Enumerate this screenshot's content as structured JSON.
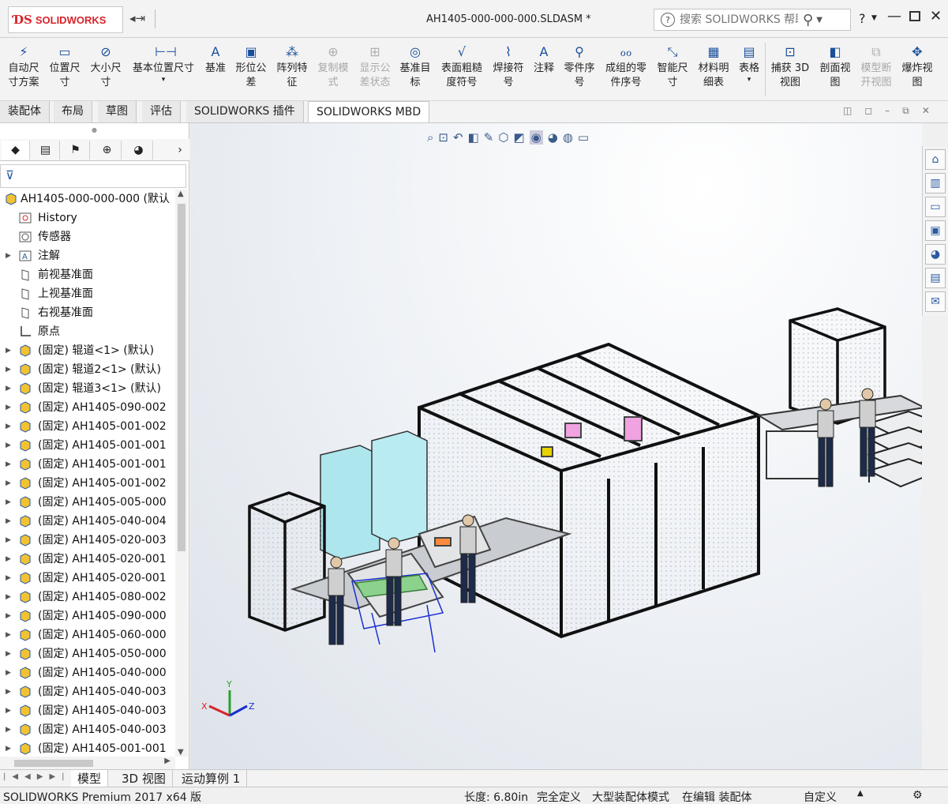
{
  "app": {
    "brand": "SOLIDWORKS",
    "doc_title": "AH1405-000-000-000.SLDASM *",
    "search_placeholder": "搜索 SOLIDWORKS 帮助",
    "help": "?"
  },
  "toolbar": {
    "items": [
      {
        "label1": "自动尺",
        "label2": "寸方案",
        "icon": "auto-dimension-icon"
      },
      {
        "label1": "位置尺",
        "label2": "寸",
        "icon": "location-dimension-icon"
      },
      {
        "label1": "大小尺",
        "label2": "寸",
        "icon": "size-dimension-icon"
      },
      {
        "label1": "基本位置尺寸",
        "label2": "",
        "icon": "basic-location-dimension-icon"
      },
      {
        "label1": "基准",
        "label2": "",
        "icon": "datum-icon"
      },
      {
        "label1": "形位公",
        "label2": "差",
        "icon": "geometric-tolerance-icon"
      },
      {
        "label1": "阵列特",
        "label2": "征",
        "icon": "pattern-feature-icon"
      },
      {
        "label1": "复制模",
        "label2": "式",
        "icon": "copy-scheme-icon"
      },
      {
        "label1": "显示公",
        "label2": "差状态",
        "icon": "show-tolerance-status-icon"
      },
      {
        "label1": "基准目",
        "label2": "标",
        "icon": "datum-target-icon"
      },
      {
        "label1": "表面粗糙",
        "label2": "度符号",
        "icon": "surface-finish-icon"
      },
      {
        "label1": "焊接符",
        "label2": "号",
        "icon": "weld-symbol-icon"
      },
      {
        "label1": "注释",
        "label2": "",
        "icon": "note-icon"
      },
      {
        "label1": "零件序",
        "label2": "号",
        "icon": "balloon-icon"
      },
      {
        "label1": "成组的零",
        "label2": "件序号",
        "icon": "stacked-balloon-icon"
      },
      {
        "label1": "智能尺",
        "label2": "寸",
        "icon": "smart-dimension-icon"
      },
      {
        "label1": "材料明",
        "label2": "细表",
        "icon": "bill-of-materials-icon"
      },
      {
        "label1": "表格",
        "label2": "",
        "icon": "table-icon"
      },
      {
        "label1": "捕获 3D",
        "label2": "视图",
        "icon": "capture-3d-view-icon"
      },
      {
        "label1": "剖面视",
        "label2": "图",
        "icon": "section-view-icon"
      },
      {
        "label1": "模型断",
        "label2": "开视图",
        "icon": "model-break-view-icon"
      },
      {
        "label1": "爆炸视",
        "label2": "图",
        "icon": "exploded-view-icon"
      }
    ]
  },
  "tabs": [
    "装配体",
    "布局",
    "草图",
    "评估",
    "SOLIDWORKS 插件",
    "SOLIDWORKS MBD"
  ],
  "tree": {
    "root": "AH1405-000-000-000 (默认",
    "items": [
      "History",
      "传感器",
      "注解",
      "前视基准面",
      "上视基准面",
      "右视基准面",
      "原点",
      "(固定) 辊道<1> (默认)",
      "(固定) 辊道2<1> (默认)",
      "(固定) 辊道3<1> (默认)",
      "(固定) AH1405-090-002",
      "(固定) AH1405-001-002",
      "(固定) AH1405-001-001",
      "(固定) AH1405-001-001",
      "(固定) AH1405-001-002",
      "(固定) AH1405-005-000",
      "(固定) AH1405-040-004",
      "(固定) AH1405-020-003",
      "(固定) AH1405-020-001",
      "(固定) AH1405-020-001",
      "(固定) AH1405-080-002",
      "(固定) AH1405-090-000",
      "(固定) AH1405-060-000",
      "(固定) AH1405-050-000",
      "(固定) AH1405-040-000",
      "(固定) AH1405-040-003",
      "(固定) AH1405-040-003",
      "(固定) AH1405-040-003",
      "(固定) AH1405-001-001"
    ]
  },
  "bottom_tabs": [
    "模型",
    "3D 视图",
    "运动算例 1"
  ],
  "status": {
    "product": "SOLIDWORKS Premium 2017 x64 版",
    "length": "长度: 6.80in",
    "defined": "完全定义",
    "mode": "大型装配体模式",
    "editing": "在编辑 装配体",
    "custom": "自定义"
  },
  "triad": {
    "x": "X",
    "y": "Y",
    "z": "Z"
  },
  "colors": {
    "brand_red": "#d8242b",
    "accent_blue": "#1a4f9a"
  }
}
